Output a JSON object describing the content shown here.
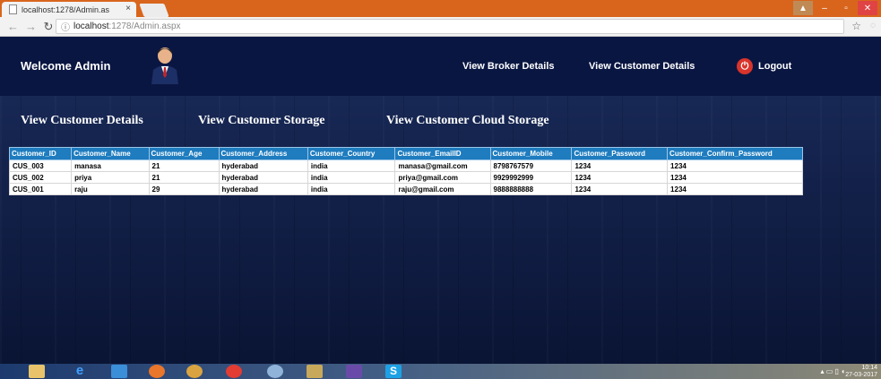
{
  "browser": {
    "tab_title": "localhost:1278/Admin.as",
    "tab_close": "×",
    "url": "localhost:1278/Admin.aspx",
    "url_host": "localhost",
    "url_rest": ":1278/Admin.aspx"
  },
  "header": {
    "welcome": "Welcome Admin",
    "links": [
      "View Broker Details",
      "View Customer Details"
    ],
    "logout": "Logout"
  },
  "sections": [
    "View Customer Details",
    "View Customer Storage",
    "View Customer Cloud Storage"
  ],
  "table": {
    "columns": [
      "Customer_ID",
      "Customer_Name",
      "Customer_Age",
      "Customer_Address",
      "Customer_Country",
      "Customer_EmailID",
      "Customer_Mobile",
      "Customer_Password",
      "Customer_Confirm_Password"
    ],
    "rows": [
      [
        "CUS_003",
        "manasa",
        "21",
        "hyderabad",
        "india",
        "manasa@gmail.com",
        "8798767579",
        "1234",
        "1234"
      ],
      [
        "CUS_002",
        "priya",
        "21",
        "hyderabad",
        "india",
        "priya@gmail.com",
        "9929992999",
        "1234",
        "1234"
      ],
      [
        "CUS_001",
        "raju",
        "29",
        "hyderabad",
        "india",
        "raju@gmail.com",
        "9888888888",
        "1234",
        "1234"
      ]
    ]
  },
  "taskbar": {
    "clock_time": "10:14",
    "clock_date": "27-03-2017"
  },
  "colors": {
    "header_bg": "#0a1642",
    "table_header": "#1e7cbf",
    "logout": "#d9342b",
    "tab_bar": "#d9651d"
  }
}
